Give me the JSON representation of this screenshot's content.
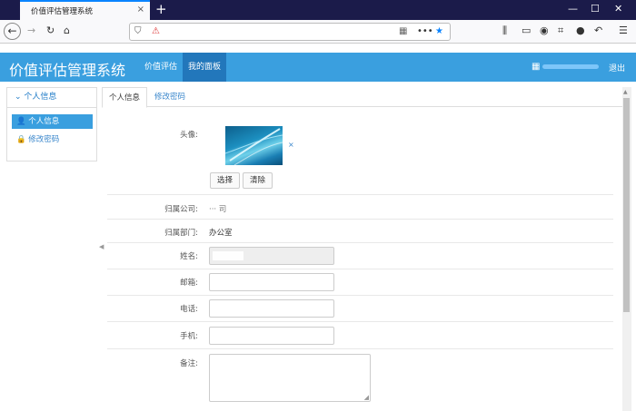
{
  "browser": {
    "tab_title": "价值评估管理系统",
    "tab_close": "×",
    "new_tab": "+"
  },
  "app": {
    "title": "价值评估管理系统",
    "menu": [
      {
        "label": "价值评估",
        "active": false
      },
      {
        "label": "我的面板",
        "active": true
      }
    ],
    "logout": "退出"
  },
  "sidebar": {
    "header": "个人信息",
    "items": [
      {
        "label": "个人信息",
        "active": true,
        "icon": "user-icon"
      },
      {
        "label": "修改密码",
        "active": false,
        "icon": "lock-icon"
      }
    ]
  },
  "tabs": [
    {
      "label": "个人信息",
      "active": true
    },
    {
      "label": "修改密码",
      "active": false
    }
  ],
  "form": {
    "avatar_label": "头像:",
    "avatar_delete": "×",
    "select_button": "选择",
    "clear_button": "清除",
    "company_label": "归属公司:",
    "company_value": "··· 司",
    "department_label": "归属部门:",
    "department_value": "办公室",
    "name_label": "姓名:",
    "email_label": "邮箱:",
    "phone_label": "电话:",
    "mobile_label": "手机:",
    "remarks_label": "备注:"
  }
}
